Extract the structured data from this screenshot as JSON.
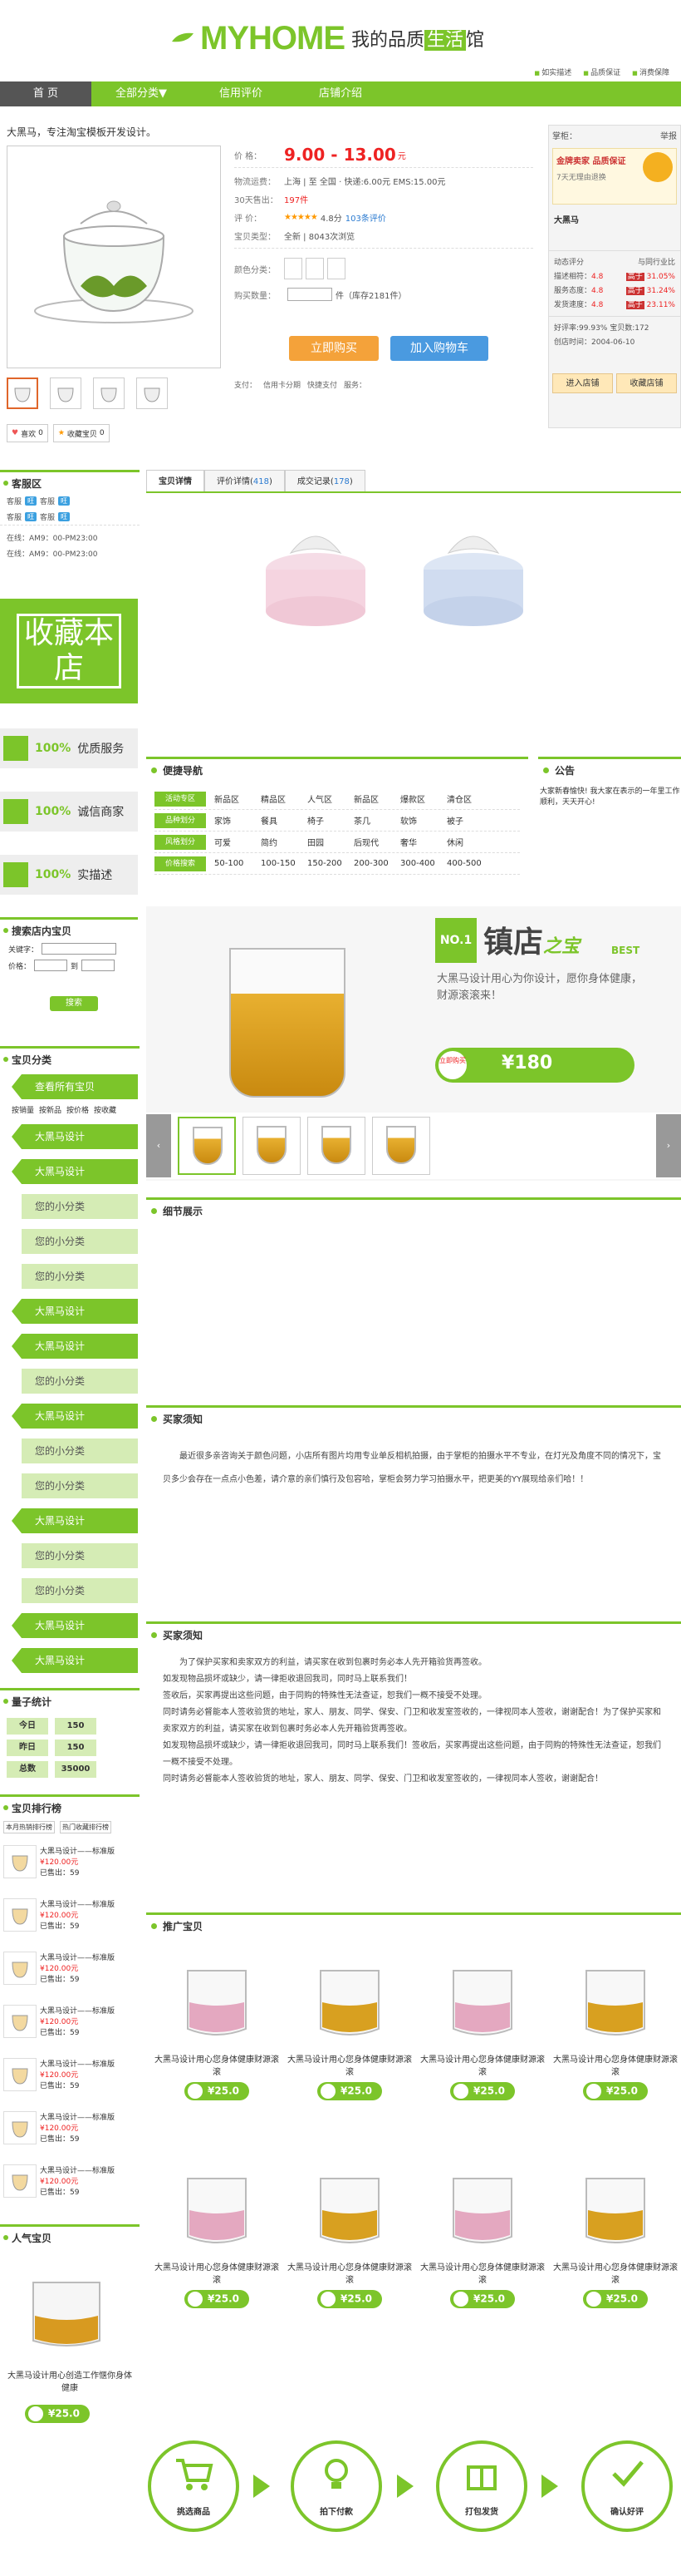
{
  "header": {
    "logo_main": "MYHOME",
    "logo_cn_a": "我的品质",
    "logo_cn_b": "生活",
    "logo_cn_c": "馆",
    "links": [
      "如实描述",
      "品质保证",
      "消费保障"
    ]
  },
  "nav": {
    "items": [
      "首 页",
      "全部分类▼",
      "信用评价",
      "店铺介绍"
    ]
  },
  "product": {
    "title": "大黑马，专注淘宝模板开发设计。",
    "price_label": "价 格：",
    "price": "9.00 - 13.00",
    "price_unit": "元",
    "ship_label": "物流运费：",
    "ship": "上海 | 至 全国 ·  快递:6.00元 EMS:15.00元",
    "sold_label": "30天售出：",
    "sold": "197件",
    "rate_label": "评   价：",
    "rate": "4.8分",
    "rate_count": "103条评价",
    "service_label": "宝贝类型：",
    "service": "全新 | 8043次浏览",
    "color_label": "颜色分类：",
    "qty_label": "购买数量：",
    "qty_unit": "件（库存2181件）",
    "buy": "立即购买",
    "cart": "加入购物车",
    "pay": [
      "支付：",
      "信用卡分期",
      "快捷支付",
      "服务："
    ],
    "share": [
      "喜欢",
      "0",
      "收藏宝贝",
      "0"
    ]
  },
  "shop": {
    "top": "掌柜：",
    "top2": "举报",
    "tag1": "金牌卖家",
    "tag2": "品质保证",
    "tag3": "7天无理由退换",
    "seller": "大黑马",
    "dyn": "动态评分",
    "cmp": "与同行业比",
    "rows": [
      {
        "k": "描述相符：",
        "v": "4.8",
        "d": "高于",
        "p": "31.05%"
      },
      {
        "k": "服务态度：",
        "v": "4.8",
        "d": "高于",
        "p": "31.24%"
      },
      {
        "k": "发货速度：",
        "v": "4.8",
        "d": "高于",
        "p": "23.11%"
      }
    ],
    "good": "好评率:99.93%  宝贝数:172",
    "since": "创店时间：2004-06-10",
    "enter": "进入店铺",
    "collect": "收藏店铺"
  },
  "sidebar": {
    "cs_title": "客服区",
    "cs_rows": [
      "客服",
      "客服",
      "客服",
      "客服"
    ],
    "hours": [
      "在线：AM9：00-PM23:00",
      "在线：AM9：00-PM23:00"
    ],
    "fav": "收藏本店",
    "guarantee": [
      {
        "p": "100%",
        "t": "优质服务"
      },
      {
        "p": "100%",
        "t": "诚信商家"
      },
      {
        "p": "100%",
        "t": "实描述"
      }
    ],
    "search_title": "搜索店内宝贝",
    "kw": "关键字：",
    "price": "价格：",
    "to": "到",
    "search_btn": "搜索",
    "cat_title": "宝贝分类",
    "view_all": "查看所有宝贝",
    "sort": [
      "按销量",
      "按新品",
      "按价格",
      "按收藏"
    ],
    "cats": [
      "大黑马设计",
      "大黑马设计",
      "您的小分类",
      "您的小分类",
      "您的小分类",
      "大黑马设计",
      "大黑马设计",
      "您的小分类",
      "大黑马设计",
      "您的小分类",
      "您的小分类",
      "大黑马设计",
      "您的小分类",
      "您的小分类",
      "大黑马设计",
      "大黑马设计"
    ],
    "stat_title": "量子统计",
    "stats": [
      {
        "k": "今日",
        "v": "150"
      },
      {
        "k": "昨日",
        "v": "150"
      },
      {
        "k": "总数",
        "v": "35000"
      }
    ],
    "rank_title": "宝贝排行榜",
    "rank_tabs": [
      "本月热销排行榜",
      "热门收藏排行榜"
    ],
    "rank": [
      {
        "n": "大黑马设计——标准版",
        "p": "¥120.00元",
        "s": "已售出：59"
      },
      {
        "n": "大黑马设计——标准版",
        "p": "¥120.00元",
        "s": "已售出：59"
      },
      {
        "n": "大黑马设计——标准版",
        "p": "¥120.00元",
        "s": "已售出：59"
      },
      {
        "n": "大黑马设计——标准版",
        "p": "¥120.00元",
        "s": "已售出：59"
      },
      {
        "n": "大黑马设计——标准版",
        "p": "¥120.00元",
        "s": "已售出：59"
      },
      {
        "n": "大黑马设计——标准版",
        "p": "¥120.00元",
        "s": "已售出：59"
      },
      {
        "n": "大黑马设计——标准版",
        "p": "¥120.00元",
        "s": "已售出：59"
      }
    ],
    "pop_title": "人气宝贝",
    "pop_name": "大黑马设计用心创造工作惬你身体健康",
    "pop_price": "¥25.0"
  },
  "tabs": {
    "items": [
      "宝贝详情",
      "评价详情",
      "成交记录"
    ],
    "counts": [
      "",
      "418",
      "178"
    ]
  },
  "nav2": {
    "title": "便捷导航",
    "rows": [
      {
        "h": "活动专区",
        "c": [
          "新品区",
          "精品区",
          "人气区",
          "新品区",
          "爆款区",
          "清仓区"
        ]
      },
      {
        "h": "品种划分",
        "c": [
          "家饰",
          "餐具",
          "椅子",
          "茶几",
          "软饰",
          "被子"
        ]
      },
      {
        "h": "风格划分",
        "c": [
          "可爱",
          "简约",
          "田园",
          "后现代",
          "奢华",
          "休闲"
        ]
      },
      {
        "h": "价格搜索",
        "c": [
          "50-100",
          "100-150",
          "150-200",
          "200-300",
          "300-400",
          "400-500"
        ]
      }
    ]
  },
  "notice": {
    "title": "公告",
    "text": "大家新春愉快! 我大家在表示的一年里工作顺利，天天开心!"
  },
  "banner": {
    "no": "NO.1",
    "title": "镇店",
    "title2": "之宝",
    "best": "BEST",
    "desc": "大黑马设计用心为你设计，愿你身体健康，财源滚滚来！",
    "buy": "立即购买",
    "price": "¥180"
  },
  "details": {
    "title": "细节展示"
  },
  "notes1": {
    "title": "买家须知",
    "text": "最近很多亲咨询关于颜色问题，小店所有图片均用专业单反相机拍摄，由于掌柜的拍摄水平不专业，在灯光及角度不同的情况下，宝贝多少会存在一点点小色差，请介意的亲们慎行及包容哈，掌柜会努力学习拍摄水平，把更美的YY展现给亲们哈！！"
  },
  "notes2": {
    "title": "买家须知",
    "lines": [
      "为了保护买家和卖家双方的利益，请买家在收到包裹时务必本人先开箱验货再签收。",
      "如发现物品损坏或缺少，请一律拒收退回我司，同时马上联系我们！",
      "签收后，买家再提出这些问题，由于同购的特殊性无法查证，恕我们一概不接受不处理。",
      "同时请务必督能本人签收验货的地址，家人、朋友、同学、保安、门卫和收发室签收的，一律视同本人签收，谢谢配合！为了保护买家和卖家双方的利益，请买家在收到包裹时务必本人先开箱验货再签收。",
      "如发现物品损坏或缺少，请一律拒收退回我司，同时马上联系我们！签收后，买家再提出这些问题，由于同购的特殊性无法查证，恕我们一概不接受不处理。",
      "同时请务必督能本人签收验货的地址，家人、朋友、同学、保安、门卫和收发室签收的，一律视同本人签收，谢谢配合！"
    ]
  },
  "promo": {
    "title": "推广宝贝",
    "items": [
      {
        "n": "大黑马设计用心您身体健康财源滚滚",
        "p": "¥25.0"
      },
      {
        "n": "大黑马设计用心您身体健康财源滚滚",
        "p": "¥25.0"
      },
      {
        "n": "大黑马设计用心您身体健康财源滚滚",
        "p": "¥25.0"
      },
      {
        "n": "大黑马设计用心您身体健康财源滚滚",
        "p": "¥25.0"
      },
      {
        "n": "大黑马设计用心您身体健康财源滚滚",
        "p": "¥25.0"
      },
      {
        "n": "大黑马设计用心您身体健康财源滚滚",
        "p": "¥25.0"
      },
      {
        "n": "大黑马设计用心您身体健康财源滚滚",
        "p": "¥25.0"
      },
      {
        "n": "大黑马设计用心您身体健康财源滚滚",
        "p": "¥25.0"
      }
    ]
  },
  "steps": [
    "挑选商品",
    "拍下付款",
    "打包发货",
    "确认好评"
  ],
  "colors": {
    "accent": "#7cc52a",
    "price": "#ee2222"
  }
}
